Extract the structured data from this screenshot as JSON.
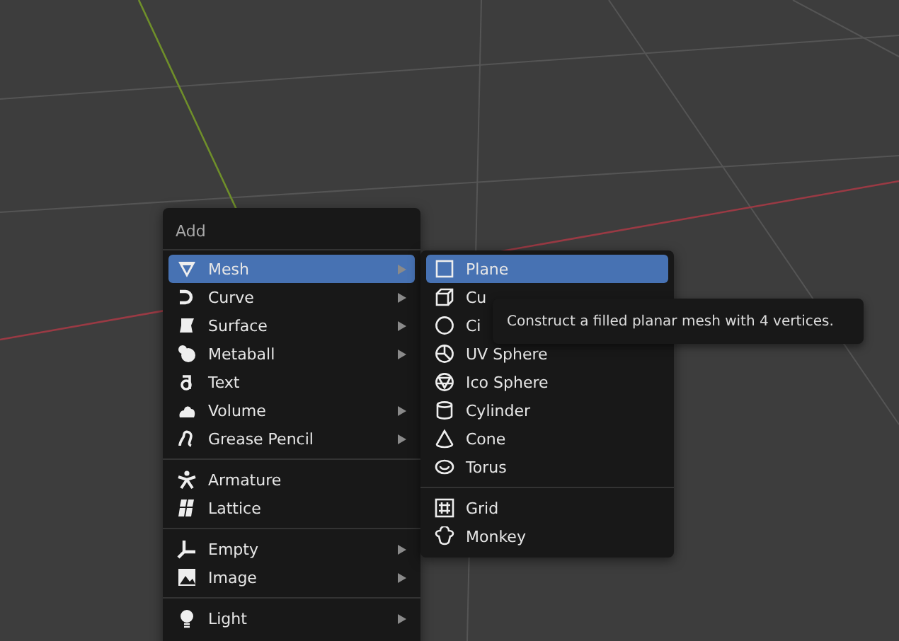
{
  "add_menu": {
    "title": "Add",
    "sections": [
      {
        "items": [
          {
            "label": "Mesh",
            "selected": true,
            "submenu": true
          },
          {
            "label": "Curve",
            "selected": false,
            "submenu": true
          },
          {
            "label": "Surface",
            "selected": false,
            "submenu": true
          },
          {
            "label": "Metaball",
            "selected": false,
            "submenu": true
          },
          {
            "label": "Text",
            "selected": false,
            "submenu": false
          },
          {
            "label": "Volume",
            "selected": false,
            "submenu": true
          },
          {
            "label": "Grease Pencil",
            "selected": false,
            "submenu": true
          }
        ]
      },
      {
        "items": [
          {
            "label": "Armature",
            "selected": false,
            "submenu": false
          },
          {
            "label": "Lattice",
            "selected": false,
            "submenu": false
          }
        ]
      },
      {
        "items": [
          {
            "label": "Empty",
            "selected": false,
            "submenu": true
          },
          {
            "label": "Image",
            "selected": false,
            "submenu": true
          }
        ]
      },
      {
        "items": [
          {
            "label": "Light",
            "selected": false,
            "submenu": true
          }
        ]
      }
    ]
  },
  "mesh_menu": {
    "sections": [
      {
        "items": [
          {
            "label": "Plane",
            "selected": true
          },
          {
            "label": "Cu",
            "selected": false
          },
          {
            "label": "Ci",
            "selected": false
          },
          {
            "label": "UV Sphere",
            "selected": false
          },
          {
            "label": "Ico Sphere",
            "selected": false
          },
          {
            "label": "Cylinder",
            "selected": false
          },
          {
            "label": "Cone",
            "selected": false
          },
          {
            "label": "Torus",
            "selected": false
          }
        ]
      },
      {
        "items": [
          {
            "label": "Grid",
            "selected": false
          },
          {
            "label": "Monkey",
            "selected": false
          }
        ]
      }
    ]
  },
  "tooltip": {
    "text": "Construct a filled planar mesh with 4 vertices."
  }
}
